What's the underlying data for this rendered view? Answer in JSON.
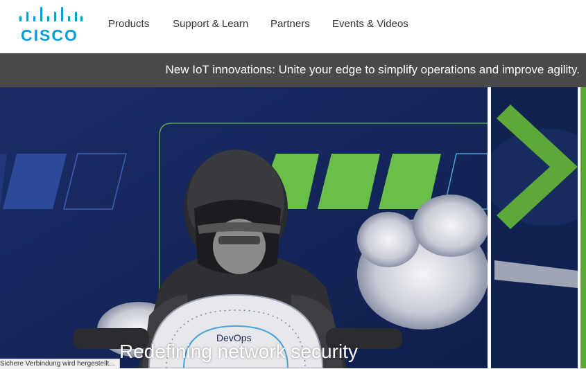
{
  "header": {
    "logo_text": "CISCO",
    "nav": [
      {
        "label": "Products"
      },
      {
        "label": "Support & Learn"
      },
      {
        "label": "Partners"
      },
      {
        "label": "Events & Videos"
      }
    ]
  },
  "banner": {
    "text": "New IoT innovations: Unite your edge to simplify operations and improve agility."
  },
  "hero": {
    "title": "Redefining network security",
    "gauge_label": "DevOps"
  },
  "status_bar": {
    "text": "Sichere Verbindung wird hergestellt..."
  },
  "colors": {
    "brand_blue": "#049fd9",
    "banner_bg": "#4a4a4a",
    "hero_bg": "#14255a",
    "accent_green": "#6abf4b"
  }
}
